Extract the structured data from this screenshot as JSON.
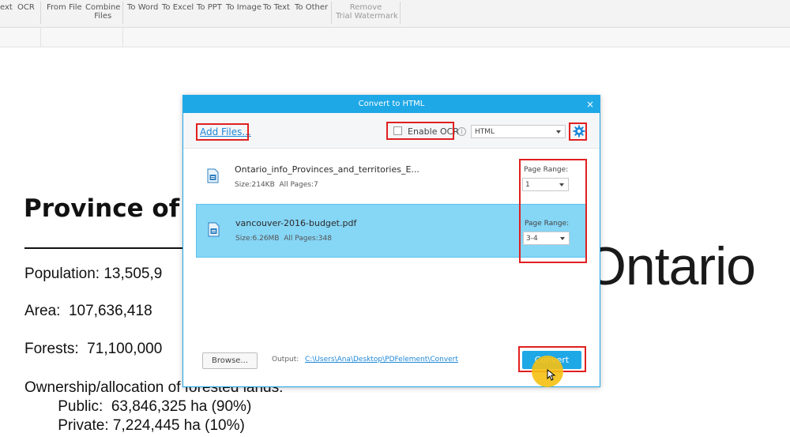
{
  "ribbon": {
    "items": [
      {
        "label": "ext",
        "disabled": false
      },
      {
        "label": "OCR",
        "disabled": false
      },
      {
        "label": "From File",
        "disabled": false
      },
      {
        "label": "Combine\nFiles",
        "disabled": false
      },
      {
        "label": "To Word",
        "disabled": false
      },
      {
        "label": "To Excel",
        "disabled": false
      },
      {
        "label": "To PPT",
        "disabled": false
      },
      {
        "label": "To Image",
        "disabled": false
      },
      {
        "label": "To Text",
        "disabled": false
      },
      {
        "label": "To Other",
        "disabled": false
      },
      {
        "label": "Remove\nTrial Watermark",
        "disabled": true
      }
    ]
  },
  "document": {
    "title": "Province of",
    "lines": [
      "Population: 13,505,9",
      "Area:  107,636,418",
      "Forests:  71,100,000",
      "Ownership/allocation of forested lands:",
      "        Public:  63,846,325 ha (90%)",
      "        Private: 7,224,445 ha (10%)"
    ],
    "logo_text": "Ontario"
  },
  "dialog": {
    "title": "Convert to HTML",
    "close": "×",
    "add_files": "Add Files...",
    "enable_ocr": "Enable OCR",
    "info": "i",
    "format": "HTML",
    "files": [
      {
        "name": "Ontario_info_Provinces_and_territories_E...",
        "size": "Size:214KB",
        "pages": "All Pages:7",
        "page_range_label": "Page Range:",
        "page_range": "1"
      },
      {
        "name": "vancouver-2016-budget.pdf",
        "size": "Size:6.26MB",
        "pages": "All Pages:348",
        "page_range_label": "Page Range:",
        "page_range": "3-4"
      }
    ],
    "browse": "Browse...",
    "output_label": "Output:",
    "output_path": "C:\\Users\\Ana\\Desktop\\PDFelement\\Convert",
    "convert": "Convert"
  },
  "colors": {
    "accent": "#1fa8e6",
    "selected_row": "#86d6f6",
    "highlight": "#e02020",
    "cursor_circle": "#f5c012"
  }
}
